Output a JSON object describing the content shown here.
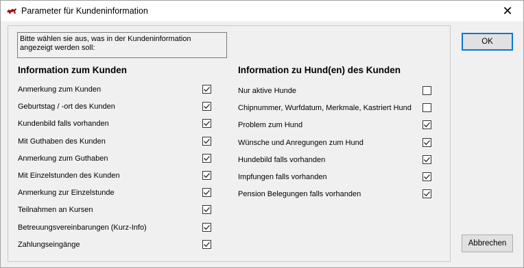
{
  "window": {
    "title": "Parameter für Kundeninformation",
    "close_glyph": "✕"
  },
  "intro_text": "Bitte wählen sie aus, was in der Kundeninformation angezeigt werden soll:",
  "left_section": {
    "title": "Information zum Kunden",
    "options": [
      {
        "label": "Anmerkung zum Kunden",
        "checked": true
      },
      {
        "label": "Geburtstag / -ort des Kunden",
        "checked": true
      },
      {
        "label": "Kundenbild falls vorhanden",
        "checked": true
      },
      {
        "label": "Mit Guthaben des Kunden",
        "checked": true
      },
      {
        "label": "Anmerkung zum Guthaben",
        "checked": true
      },
      {
        "label": "Mit Einzelstunden des Kunden",
        "checked": true
      },
      {
        "label": "Anmerkung zur Einzelstunde",
        "checked": true
      },
      {
        "label": "Teilnahmen an Kursen",
        "checked": true
      },
      {
        "label": "Betreuungsvereinbarungen (Kurz-Info)",
        "checked": true
      },
      {
        "label": "Zahlungseingänge",
        "checked": true
      }
    ]
  },
  "right_section": {
    "title": "Information zu Hund(en) des Kunden",
    "options": [
      {
        "label": "Nur aktive Hunde",
        "checked": false
      },
      {
        "label": "Chipnummer, Wurfdatum, Merkmale, Kastriert Hund",
        "checked": false
      },
      {
        "label": "Problem zum Hund",
        "checked": true
      },
      {
        "label": "Wünsche und Anregungen zum Hund",
        "checked": true
      },
      {
        "label": "Hundebild falls vorhanden",
        "checked": true
      },
      {
        "label": "Impfungen falls vorhanden",
        "checked": true
      },
      {
        "label": "Pension Belegungen falls vorhanden",
        "checked": true
      }
    ]
  },
  "buttons": {
    "ok": "OK",
    "cancel": "Abbrechen"
  },
  "colors": {
    "titlebar": "#ffffff",
    "background": "#f0f0f0",
    "default_button_border": "#0078d7"
  }
}
